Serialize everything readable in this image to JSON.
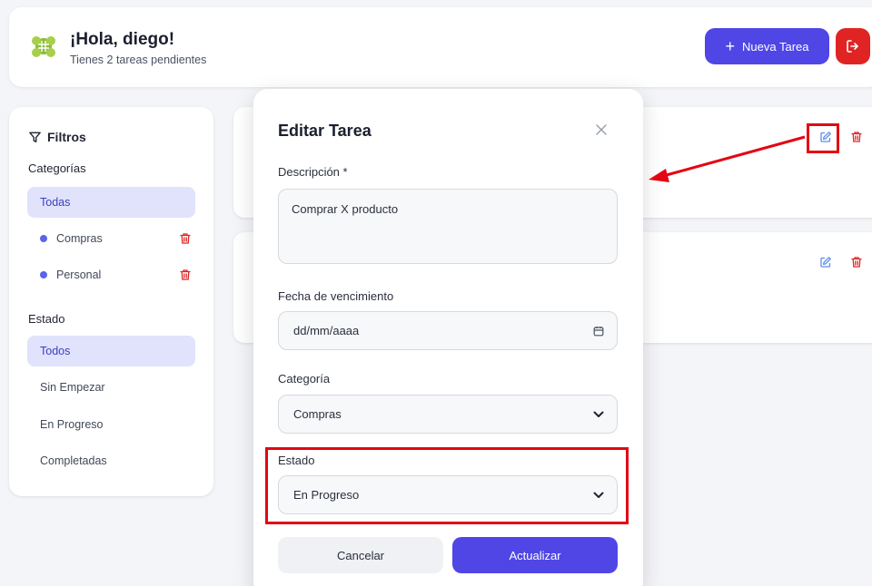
{
  "header": {
    "title": "¡Hola, diego!",
    "subtitle": "Tienes 2 tareas pendientes",
    "new_task_label": "Nueva Tarea"
  },
  "sidebar": {
    "filters_title": "Filtros",
    "categories_label": "Categorías",
    "categories": [
      {
        "label": "Todas",
        "active": true
      },
      {
        "label": "Compras"
      },
      {
        "label": "Personal"
      }
    ],
    "status_label": "Estado",
    "statuses": [
      {
        "label": "Todos",
        "active": true
      },
      {
        "label": "Sin Empezar"
      },
      {
        "label": "En Progreso"
      },
      {
        "label": "Completadas"
      }
    ]
  },
  "modal": {
    "title": "Editar Tarea",
    "description_label": "Descripción *",
    "description_value": "Comprar X producto",
    "due_label": "Fecha de vencimiento",
    "due_placeholder": "dd/mm/aaaa",
    "category_label": "Categoría",
    "category_value": "Compras",
    "status_label": "Estado",
    "status_value": "En Progreso",
    "cancel_label": "Cancelar",
    "update_label": "Actualizar"
  },
  "colors": {
    "accent": "#4f46e5",
    "danger": "#e02424",
    "highlight": "#e30613"
  }
}
